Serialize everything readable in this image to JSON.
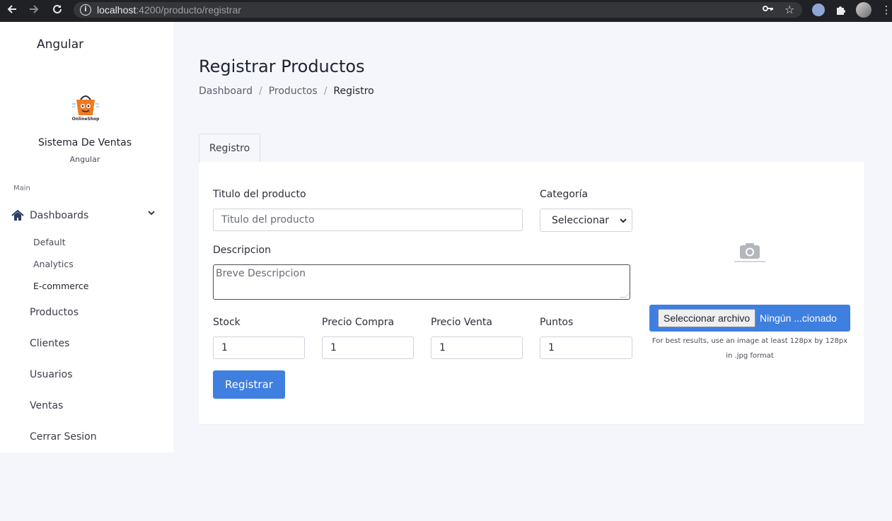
{
  "browser": {
    "url_host": "localhost",
    "url_rest": ":4200/producto/registrar",
    "icons": {
      "back": "arrow-left-icon",
      "forward": "arrow-right-icon",
      "reload": "reload-icon",
      "site_info": "info-icon",
      "key": "key-icon",
      "bookmark": "star-icon",
      "extension": "puzzle-icon",
      "menu": "kebab-menu-icon"
    }
  },
  "sidebar": {
    "brand": "Angular",
    "logo_text": "OnlineShop",
    "system_name": "Sistema De Ventas",
    "system_sub": "Angular",
    "section_label": "Main",
    "dashboards_label": "Dashboards",
    "dashboards_sub": [
      "Default",
      "Analytics",
      "E-commerce"
    ],
    "items": [
      {
        "label": "Productos"
      },
      {
        "label": "Clientes"
      },
      {
        "label": "Usuarios"
      },
      {
        "label": "Ventas"
      },
      {
        "label": "Cerrar Sesion"
      }
    ]
  },
  "main": {
    "title": "Registrar Productos",
    "breadcrumb": [
      "Dashboard",
      "Productos",
      "Registro"
    ],
    "tab": "Registro",
    "form": {
      "titulo_label": "Titulo del producto",
      "titulo_placeholder": "Titulo del producto",
      "categoria_label": "Categoría",
      "categoria_value": "Seleccionar",
      "descripcion_label": "Descripcion",
      "descripcion_placeholder": "Breve Descripcion",
      "stock_label": "Stock",
      "stock_value": "1",
      "precio_compra_label": "Precio Compra",
      "precio_compra_value": "1",
      "precio_venta_label": "Precio Venta",
      "precio_venta_value": "1",
      "puntos_label": "Puntos",
      "puntos_value": "1",
      "submit_label": "Registrar"
    },
    "image": {
      "placeholder_icon": "camera-icon",
      "file_button": "Seleccionar archivo",
      "file_status": "Ningún ...cionado",
      "hint": "For best results, use an image at least 128px by 128px in .jpg format"
    }
  },
  "colors": {
    "primary": "#3f7fe0",
    "sidebar_bg": "#ffffff",
    "page_bg": "#f4f6fb",
    "menu_icon": "#2a3b66"
  }
}
